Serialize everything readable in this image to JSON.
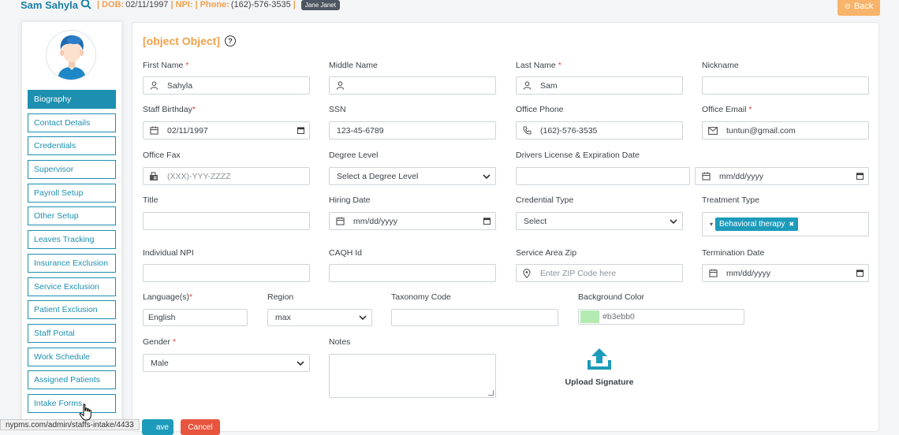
{
  "header": {
    "patient_name": "Sam Sahyla",
    "dob_label": "DOB:",
    "dob": "02/11/1997",
    "npi_label": "NPI:",
    "phone_label": "Phone:",
    "phone": "(162)-576-3535",
    "badge": "Jane Janet",
    "back_label": "Back"
  },
  "sidebar": {
    "items": [
      {
        "label": "Biography",
        "active": true
      },
      {
        "label": "Contact Details"
      },
      {
        "label": "Credentials"
      },
      {
        "label": "Supervisor"
      },
      {
        "label": "Payroll Setup"
      },
      {
        "label": "Other Setup"
      },
      {
        "label": "Leaves Tracking"
      },
      {
        "label": "Insurance Exclusion"
      },
      {
        "label": "Service Exclusion"
      },
      {
        "label": "Patient Exclusion"
      },
      {
        "label": "Staff Portal"
      },
      {
        "label": "Work Schedule"
      },
      {
        "label": "Assigned Patients"
      },
      {
        "label": "Intake Forms"
      }
    ]
  },
  "form": {
    "title": {
      "label": "Title",
      "value": ""
    },
    "first_name": {
      "label": "First Name",
      "value": "Sahyla"
    },
    "middle_name": {
      "label": "Middle Name",
      "value": ""
    },
    "last_name": {
      "label": "Last Name",
      "value": "Sam"
    },
    "nickname": {
      "label": "Nickname",
      "value": ""
    },
    "birthday": {
      "label": "Staff Birthday",
      "value": "02/11/1997"
    },
    "ssn": {
      "label": "SSN",
      "value": "123-45-6789"
    },
    "office_phone": {
      "label": "Office Phone",
      "value": "(162)-576-3535"
    },
    "office_email": {
      "label": "Office Email",
      "value": "tuntun@gmail.com"
    },
    "office_fax": {
      "label": "Office Fax",
      "placeholder": "(XXX)-YYY-ZZZZ"
    },
    "degree_level": {
      "label": "Degree Level",
      "value": "Select a Degree Level"
    },
    "drivers_license": {
      "label": "Drivers License & Expiration Date",
      "value": "",
      "date_placeholder": "mm/dd/yyyy"
    },
    "hiring_date": {
      "label": "Hiring Date",
      "placeholder": "mm/dd/yyyy"
    },
    "credential_type": {
      "label": "Credential Type",
      "value": "Select"
    },
    "treatment_type": {
      "label": "Treatment Type",
      "tag": "Behavioral therapy"
    },
    "individual_npi": {
      "label": "Individual NPI",
      "value": ""
    },
    "caqh_id": {
      "label": "CAQH Id",
      "value": ""
    },
    "service_area_zip": {
      "label": "Service Area Zip",
      "placeholder": "Enter ZIP Code here"
    },
    "termination_date": {
      "label": "Termination Date",
      "placeholder": "mm/dd/yyyy"
    },
    "language": {
      "label": "Language(s)",
      "value": "English"
    },
    "region": {
      "label": "Region",
      "value": "max"
    },
    "taxonomy_code": {
      "label": "Taxonomy Code",
      "value": ""
    },
    "background_color": {
      "label": "Background Color",
      "value": "#b3ebb0"
    },
    "gender": {
      "label": "Gender",
      "value": "Male"
    },
    "notes": {
      "label": "Notes",
      "value": ""
    },
    "upload_signature": "Upload Signature",
    "required_mark": "*"
  },
  "footer": {
    "save_label": "ave",
    "cancel_label": "Cancel",
    "status_url": "nypms.com/admin/staffs-intake/4433"
  },
  "colors": {
    "accent": "#1d8fb1",
    "title": "#f0a14a",
    "required": "#e0443a",
    "cancel": "#e8553f",
    "back": "#f7b46a"
  }
}
